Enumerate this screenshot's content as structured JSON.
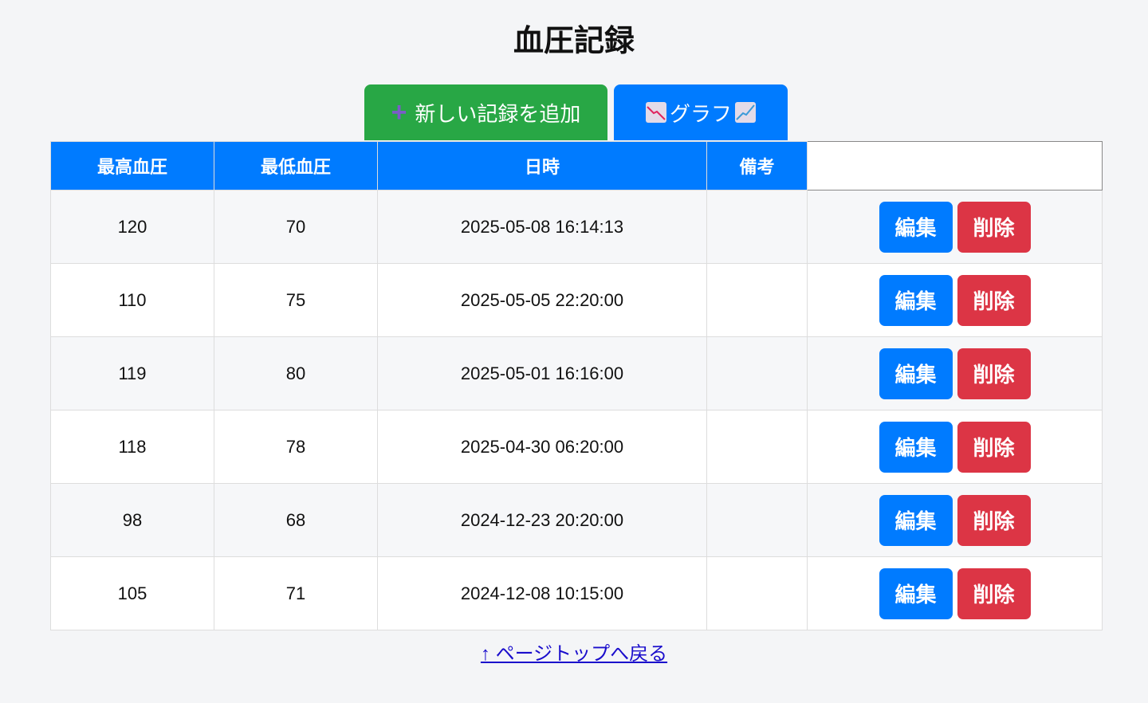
{
  "title": "血圧記録",
  "toolbar": {
    "add_label": "新しい記録を追加",
    "add_icon": "plus-icon",
    "graph_label": "グラフ",
    "graph_icons": [
      "chart-decreasing-icon",
      "chart-increasing-icon"
    ]
  },
  "table": {
    "headers": [
      "最高血圧",
      "最低血圧",
      "日時",
      "備考",
      ""
    ],
    "rows": [
      {
        "sys": "120",
        "dia": "70",
        "datetime": "2025-05-08 16:14:13",
        "note": ""
      },
      {
        "sys": "110",
        "dia": "75",
        "datetime": "2025-05-05 22:20:00",
        "note": ""
      },
      {
        "sys": "119",
        "dia": "80",
        "datetime": "2025-05-01 16:16:00",
        "note": ""
      },
      {
        "sys": "118",
        "dia": "78",
        "datetime": "2025-04-30 06:20:00",
        "note": ""
      },
      {
        "sys": "98",
        "dia": "68",
        "datetime": "2024-12-23 20:20:00",
        "note": ""
      },
      {
        "sys": "105",
        "dia": "71",
        "datetime": "2024-12-08 10:15:00",
        "note": ""
      }
    ],
    "edit_label": "編集",
    "delete_label": "削除"
  },
  "back_to_top": "↑ ページトップへ戻る",
  "colors": {
    "green": "#28a745",
    "blue": "#007bff",
    "red": "#dc3545"
  }
}
